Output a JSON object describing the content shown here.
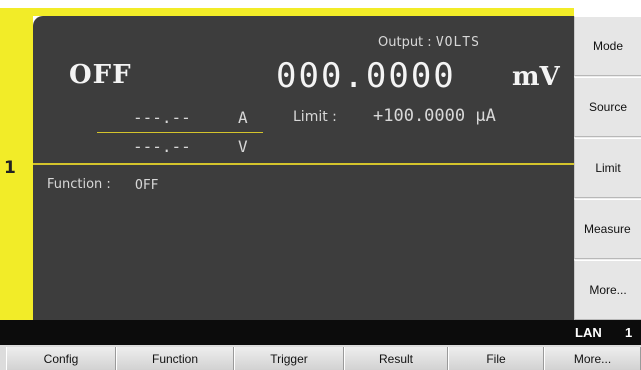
{
  "channel": {
    "number": "1"
  },
  "display": {
    "output_label": "Output :",
    "output_mode": "VOLTS",
    "output_state": "OFF",
    "reading_value": "000.0000",
    "reading_unit": "mV",
    "current_measure": "---.--",
    "current_unit": "A",
    "voltage_measure": "---.--",
    "voltage_unit": "V",
    "limit_label": "Limit :",
    "limit_value": "+100.0000 µA",
    "function_label": "Function :",
    "function_value": "OFF"
  },
  "softkeys": [
    {
      "label": "Mode"
    },
    {
      "label": "Source"
    },
    {
      "label": "Limit"
    },
    {
      "label": "Measure"
    },
    {
      "label": "More..."
    }
  ],
  "status_bar": {
    "connection": "LAN",
    "channel": "1"
  },
  "bottom_menu": [
    {
      "label": "Config"
    },
    {
      "label": "Function"
    },
    {
      "label": "Trigger"
    },
    {
      "label": "Result"
    },
    {
      "label": "File"
    },
    {
      "label": "More..."
    }
  ],
  "colors": {
    "accent_yellow": "#f2ec28",
    "panel": "#3d3d3d",
    "divider": "#d4c42c"
  }
}
